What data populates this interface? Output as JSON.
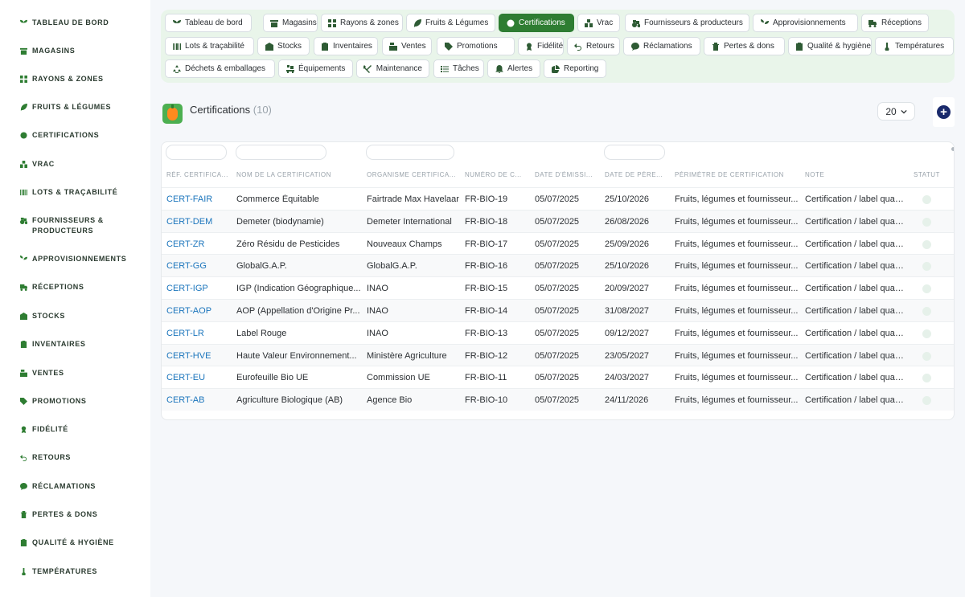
{
  "sidebar": {
    "items": [
      {
        "label": "Tableau de bord",
        "icon": "sprout-icon"
      },
      {
        "label": "Magasins",
        "icon": "store-icon"
      },
      {
        "label": "Rayons & zones",
        "icon": "grid-icon"
      },
      {
        "label": "Fruits & légumes",
        "icon": "leaf-icon"
      },
      {
        "label": "Certifications",
        "icon": "badge-icon"
      },
      {
        "label": "Vrac",
        "icon": "boxes-icon"
      },
      {
        "label": "Lots & traçabilité",
        "icon": "barcode-icon"
      },
      {
        "label": "Fournisseurs & producteurs",
        "icon": "tractor-icon"
      },
      {
        "label": "Approvisionnements",
        "icon": "seedling-icon"
      },
      {
        "label": "Réceptions",
        "icon": "truck-icon"
      },
      {
        "label": "Stocks",
        "icon": "warehouse-icon"
      },
      {
        "label": "Inventaires",
        "icon": "clipboard-icon"
      },
      {
        "label": "Ventes",
        "icon": "cash-register-icon"
      },
      {
        "label": "Promotions",
        "icon": "tags-icon"
      },
      {
        "label": "Fidélité",
        "icon": "medal-icon"
      },
      {
        "label": "Retours",
        "icon": "undo-icon"
      },
      {
        "label": "Réclamations",
        "icon": "comment-icon"
      },
      {
        "label": "Pertes & dons",
        "icon": "trash-icon"
      },
      {
        "label": "Qualité & hygiène",
        "icon": "clipboard-check-icon"
      },
      {
        "label": "Températures",
        "icon": "thermometer-icon"
      }
    ]
  },
  "nav": {
    "chips": [
      {
        "label": "Tableau de bord",
        "icon": "sprout-icon",
        "active": false
      },
      {
        "label": "Magasins",
        "icon": "store-icon",
        "active": false
      },
      {
        "label": "Rayons & zones",
        "icon": "grid-icon",
        "active": false
      },
      {
        "label": "Fruits & Légumes",
        "icon": "leaf-icon",
        "active": false
      },
      {
        "label": "Certifications",
        "icon": "badge-icon",
        "active": true
      },
      {
        "label": "Vrac",
        "icon": "boxes-icon",
        "active": false
      },
      {
        "label": "Fournisseurs & producteurs",
        "icon": "tractor-icon",
        "active": false
      },
      {
        "label": "Approvisionnements",
        "icon": "seedling-icon",
        "active": false
      },
      {
        "label": "Réceptions",
        "icon": "truck-icon",
        "active": false
      },
      {
        "label": "Lots & traçabilité",
        "icon": "barcode-icon",
        "active": false
      },
      {
        "label": "Stocks",
        "icon": "warehouse-icon",
        "active": false
      },
      {
        "label": "Inventaires",
        "icon": "clipboard-icon",
        "active": false
      },
      {
        "label": "Ventes",
        "icon": "cash-register-icon",
        "active": false
      },
      {
        "label": "Promotions",
        "icon": "tags-icon",
        "active": false
      },
      {
        "label": "Fidélité",
        "icon": "medal-icon",
        "active": false
      },
      {
        "label": "Retours",
        "icon": "undo-icon",
        "active": false
      },
      {
        "label": "Réclamations",
        "icon": "comment-icon",
        "active": false
      },
      {
        "label": "Pertes & dons",
        "icon": "trash-icon",
        "active": false
      },
      {
        "label": "Qualité & hygiène",
        "icon": "clipboard-check-icon",
        "active": false
      },
      {
        "label": "Températures",
        "icon": "thermometer-icon",
        "active": false
      },
      {
        "label": "Déchets & emballages",
        "icon": "recycle-icon",
        "active": false
      },
      {
        "label": "Équipements",
        "icon": "pallet-icon",
        "active": false
      },
      {
        "label": "Maintenance",
        "icon": "tools-icon",
        "active": false
      },
      {
        "label": "Tâches",
        "icon": "tasks-icon",
        "active": false
      },
      {
        "label": "Alertes",
        "icon": "bell-icon",
        "active": false
      },
      {
        "label": "Reporting",
        "icon": "pie-chart-icon",
        "active": false
      }
    ]
  },
  "page": {
    "title": "Certifications",
    "count": "(10)",
    "per_page": "20"
  },
  "table": {
    "columns": [
      "Réf. certifica...",
      "Nom de la certification",
      "Organisme certifica...",
      "Numéro de c...",
      "Date d'émissi...",
      "Date de pére...",
      "Périmètre de certification",
      "Note",
      "Statut"
    ],
    "rows": [
      [
        "CERT-FAIR",
        "Commerce Équitable",
        "Fairtrade Max Havelaar",
        "FR-BIO-19",
        "05/07/2025",
        "25/10/2026",
        "Fruits, légumes et fournisseur...",
        "Certification / label qualité."
      ],
      [
        "CERT-DEM",
        "Demeter (biodynamie)",
        "Demeter International",
        "FR-BIO-18",
        "05/07/2025",
        "26/08/2026",
        "Fruits, légumes et fournisseur...",
        "Certification / label qualité."
      ],
      [
        "CERT-ZR",
        "Zéro Résidu de Pesticides",
        "Nouveaux Champs",
        "FR-BIO-17",
        "05/07/2025",
        "25/09/2026",
        "Fruits, légumes et fournisseur...",
        "Certification / label qualité."
      ],
      [
        "CERT-GG",
        "GlobalG.A.P.",
        "GlobalG.A.P.",
        "FR-BIO-16",
        "05/07/2025",
        "25/10/2026",
        "Fruits, légumes et fournisseur...",
        "Certification / label qualité."
      ],
      [
        "CERT-IGP",
        "IGP (Indication Géographique...",
        "INAO",
        "FR-BIO-15",
        "05/07/2025",
        "20/09/2027",
        "Fruits, légumes et fournisseur...",
        "Certification / label qualité."
      ],
      [
        "CERT-AOP",
        "AOP (Appellation d'Origine Pr...",
        "INAO",
        "FR-BIO-14",
        "05/07/2025",
        "31/08/2027",
        "Fruits, légumes et fournisseur...",
        "Certification / label qualité."
      ],
      [
        "CERT-LR",
        "Label Rouge",
        "INAO",
        "FR-BIO-13",
        "05/07/2025",
        "09/12/2027",
        "Fruits, légumes et fournisseur...",
        "Certification / label qualité."
      ],
      [
        "CERT-HVE",
        "Haute Valeur Environnement...",
        "Ministère Agriculture",
        "FR-BIO-12",
        "05/07/2025",
        "23/05/2027",
        "Fruits, légumes et fournisseur...",
        "Certification / label qualité."
      ],
      [
        "CERT-EU",
        "Eurofeuille Bio UE",
        "Commission UE",
        "FR-BIO-11",
        "05/07/2025",
        "24/03/2027",
        "Fruits, légumes et fournisseur...",
        "Certification / label qualité."
      ],
      [
        "CERT-AB",
        "Agriculture Biologique (AB)",
        "Agence Bio",
        "FR-BIO-10",
        "05/07/2025",
        "24/11/2026",
        "Fruits, légumes et fournisseur...",
        "Certification / label qualité."
      ]
    ]
  },
  "colors": {
    "accent": "#2e7d32",
    "link": "#1b75bc",
    "nav_bg": "#e9f5ea",
    "add_button": "#1a2a6c"
  }
}
